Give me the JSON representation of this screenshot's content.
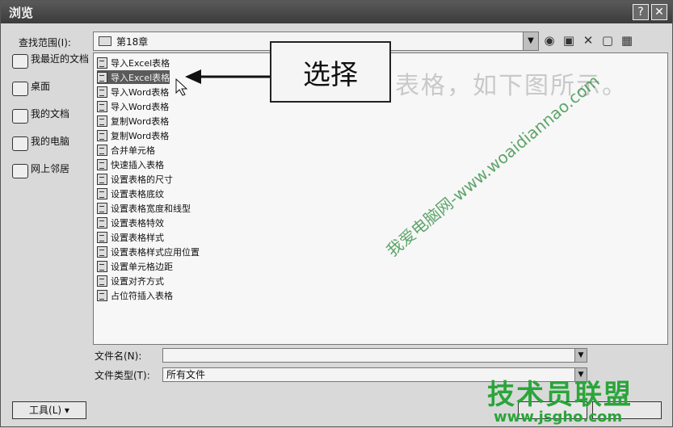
{
  "window": {
    "title": "浏览",
    "help_label": "?",
    "close_label": "✕"
  },
  "toolbar": {
    "lookin_label": "查找范围(I):",
    "lookin_value": "第18章",
    "icons": [
      "back-icon",
      "up-folder-icon",
      "delete-icon",
      "new-folder-icon",
      "views-icon"
    ]
  },
  "places": [
    {
      "label": "我最近的文档",
      "icon": "recent-icon"
    },
    {
      "label": "桌面",
      "icon": "desktop-icon"
    },
    {
      "label": "我的文档",
      "icon": "my-documents-icon"
    },
    {
      "label": "我的电脑",
      "icon": "my-computer-icon"
    },
    {
      "label": "网上邻居",
      "icon": "network-icon"
    }
  ],
  "files": [
    {
      "name": "导入Excel表格",
      "selected": false
    },
    {
      "name": "导入Excel表格",
      "selected": true
    },
    {
      "name": "导入Word表格",
      "selected": false
    },
    {
      "name": "导入Word表格",
      "selected": false
    },
    {
      "name": "复制Word表格",
      "selected": false
    },
    {
      "name": "复制Word表格",
      "selected": false
    },
    {
      "name": "合并单元格",
      "selected": false
    },
    {
      "name": "快速插入表格",
      "selected": false
    },
    {
      "name": "设置表格的尺寸",
      "selected": false
    },
    {
      "name": "设置表格底纹",
      "selected": false
    },
    {
      "name": "设置表格宽度和线型",
      "selected": false
    },
    {
      "name": "设置表格特效",
      "selected": false
    },
    {
      "name": "设置表格样式",
      "selected": false
    },
    {
      "name": "设置表格样式应用位置",
      "selected": false
    },
    {
      "name": "设置单元格边距",
      "selected": false
    },
    {
      "name": "设置对齐方式",
      "selected": false
    },
    {
      "name": "占位符插入表格",
      "selected": false
    }
  ],
  "callout": {
    "text": "选择"
  },
  "background_text": "表格，如下图所示。",
  "fields": {
    "filename_label": "文件名(N):",
    "filename_value": "",
    "filetype_label": "文件类型(T):",
    "filetype_value": "所有文件"
  },
  "buttons": {
    "tools_label": "工具(L) ▾"
  },
  "watermarks": {
    "diagonal": "我爱电脑网-www.woaidiannao.com",
    "logo": "技术员联盟",
    "url": "www.jsgho.com"
  }
}
